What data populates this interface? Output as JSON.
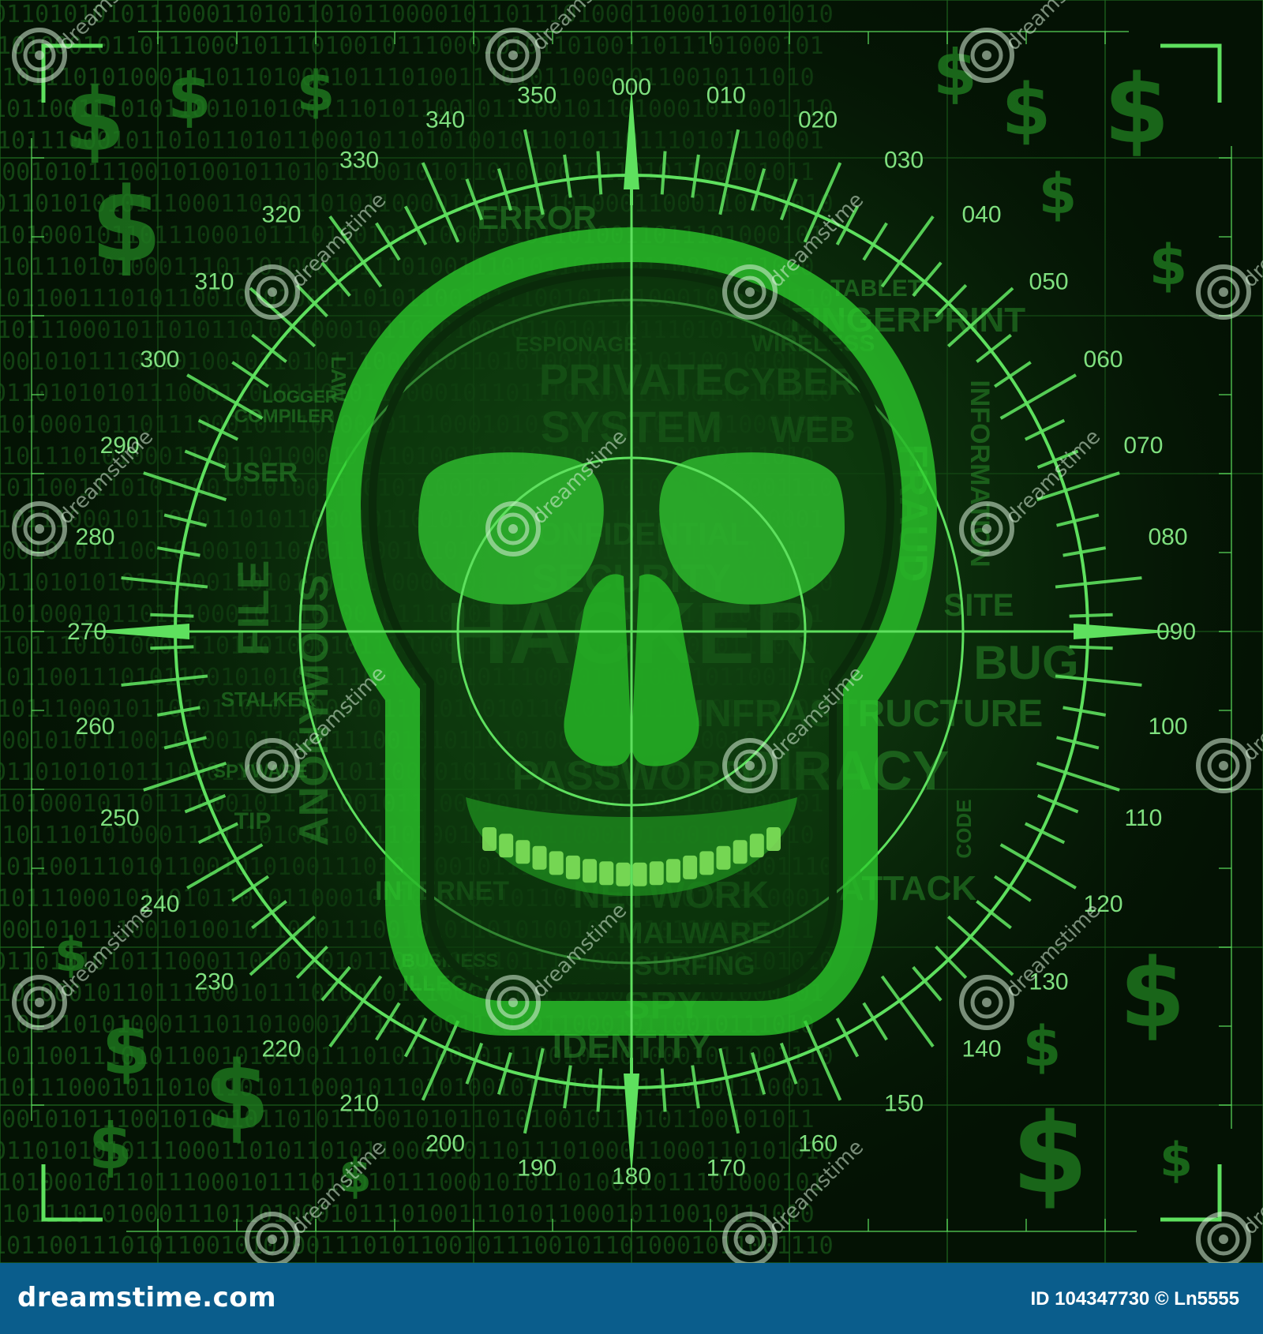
{
  "scene": {
    "binary_rows": [
      "0110101010111000110101101011000010110111010001100",
      "1101000101101110001011101001011100010101101001101",
      "0010111010100011101101000101110100111010110001011",
      "1011001110101100101010011101011001011100101101000",
      "0101110001011010110101100010110101001011010110111",
      "1100101011100101001011010111001010110101001011010"
    ],
    "word_cloud": [
      "ERROR",
      "ESPIONAGE",
      "PRIVATE",
      "SYSTEM",
      "CYBER",
      "WEB",
      "TABLET",
      "FINGERPRINT",
      "WIRELESS",
      "INFORMATION",
      "FILE",
      "ANONYMOUS",
      "HACKER",
      "BUG",
      "INFRASTRUCTURE",
      "PASSWORD",
      "PIRACY",
      "STALKER",
      "SPYWARE",
      "TIP",
      "INTERNET",
      "NETWORK",
      "ATTACK",
      "MALWARE",
      "SURFING",
      "SPY",
      "BUSINESS",
      "ILLEGAL",
      "USER",
      "LAW",
      "COMPILER",
      "LOGGER",
      "CODE",
      "FRAUD",
      "SECURITY",
      "CONFIDENTIAL",
      "IDENTITY",
      "SITE"
    ],
    "bearings": [
      "000",
      "010",
      "020",
      "030",
      "040",
      "050",
      "060",
      "070",
      "080",
      "090",
      "100",
      "110",
      "120",
      "130",
      "140",
      "150",
      "160",
      "170",
      "180",
      "190",
      "200",
      "210",
      "220",
      "230",
      "240",
      "250",
      "260",
      "270",
      "280",
      "290",
      "300",
      "310",
      "320",
      "330",
      "340",
      "350"
    ],
    "watermark_text": "dreamstime",
    "colors": {
      "background": "#041204",
      "grid": "#1f6a1f",
      "accent": "#5ee05e",
      "dim_green": "#1a5a1a",
      "footer": "#0a5d8c"
    },
    "icons": {
      "skull": "skull-icon",
      "crosshair": "crosshair-icon",
      "dollar": "dollar-sign-icon",
      "watermark": "dreamstime-spiral-icon"
    }
  },
  "footer": {
    "logo": "dreamstime.com",
    "id_text": "ID 104347730 © Ln5555"
  }
}
